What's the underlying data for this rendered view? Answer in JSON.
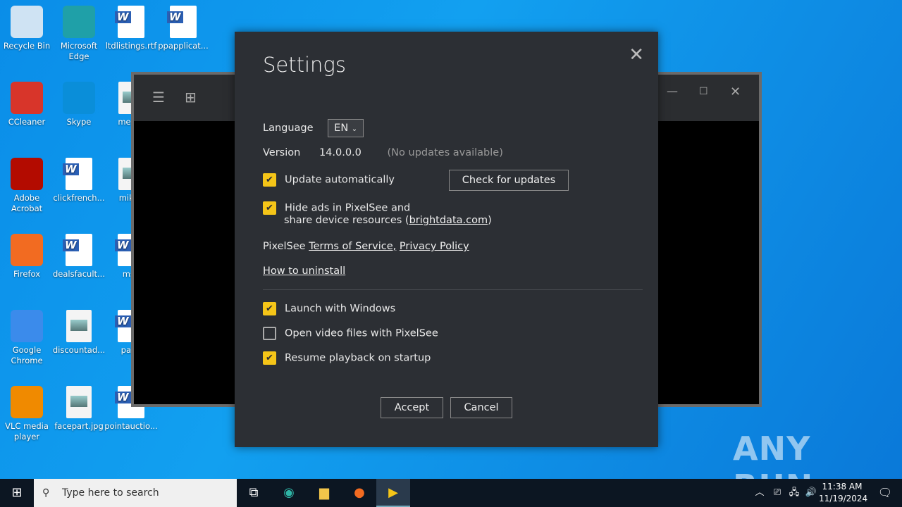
{
  "desktop_icons": [
    {
      "label": "Recycle Bin",
      "color": "#cfe3f3"
    },
    {
      "label": "Microsoft Edge",
      "color": "#1fa0a8"
    },
    {
      "label": "ltdlistings.rtf",
      "type": "word"
    },
    {
      "label": "ppapplicat...",
      "type": "word"
    },
    {
      "label": "CCleaner",
      "color": "#d8352a"
    },
    {
      "label": "Skype",
      "color": "#0a8ed9"
    },
    {
      "label": "messa",
      "type": "pic"
    },
    {
      "label": "Adobe Acrobat",
      "color": "#b30b00"
    },
    {
      "label": "clickfrench...",
      "type": "word"
    },
    {
      "label": "mikev",
      "type": "pic"
    },
    {
      "label": "Firefox",
      "color": "#f26b21"
    },
    {
      "label": "dealsfacult...",
      "type": "word"
    },
    {
      "label": "msn",
      "type": "word"
    },
    {
      "label": "Google Chrome",
      "color": "#3b8beb"
    },
    {
      "label": "discountad...",
      "type": "pic"
    },
    {
      "label": "pane",
      "type": "word"
    },
    {
      "label": "VLC media player",
      "color": "#f08a00"
    },
    {
      "label": "facepart.jpg",
      "type": "pic"
    },
    {
      "label": "pointauctio...",
      "type": "word"
    }
  ],
  "dialog": {
    "title": "Settings",
    "language_label": "Language",
    "language_value": "EN",
    "version_label": "Version",
    "version_value": "14.0.0.0",
    "update_status": "(No updates available)",
    "update_auto": {
      "label": "Update automatically",
      "checked": true
    },
    "check_updates": "Check for updates",
    "hide_ads": {
      "label_1": "Hide ads in PixelSee and",
      "label_2": "share device resources (",
      "link": "brightdata.com",
      "label_3": ")",
      "checked": true
    },
    "tos_prefix": "PixelSee ",
    "tos": "Terms of Service,",
    "privacy": "Privacy Policy",
    "uninstall": "How to uninstall",
    "launch": {
      "label": "Launch with Windows",
      "checked": true
    },
    "open_video": {
      "label": "Open video files with PixelSee",
      "checked": false
    },
    "resume": {
      "label": "Resume playback on startup",
      "checked": true
    },
    "accept": "Accept",
    "cancel": "Cancel"
  },
  "taskbar": {
    "search_placeholder": "Type here to search",
    "time": "11:38 AM",
    "date": "11/19/2024"
  },
  "watermark": "ANY RUN"
}
